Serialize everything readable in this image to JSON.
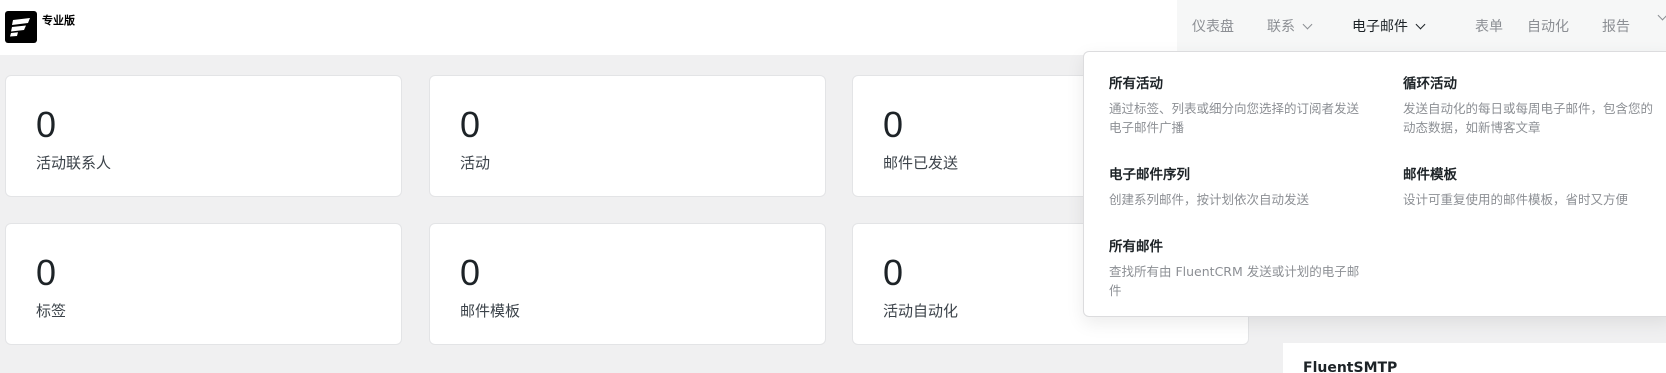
{
  "app": {
    "badge": "专业版"
  },
  "nav": {
    "items": [
      {
        "label": "仪表盘",
        "has_chevron": false,
        "active": false
      },
      {
        "label": "联系",
        "has_chevron": true,
        "active": false
      },
      {
        "label": "电子邮件",
        "has_chevron": true,
        "active": true
      },
      {
        "label": "表单",
        "has_chevron": false,
        "active": false
      },
      {
        "label": "自动化",
        "has_chevron": false,
        "active": false
      },
      {
        "label": "报告",
        "has_chevron": false,
        "active": false
      }
    ]
  },
  "stats": [
    {
      "value": "0",
      "label": "活动联系人"
    },
    {
      "value": "0",
      "label": "活动"
    },
    {
      "value": "0",
      "label": "邮件已发送"
    },
    {
      "value": "0",
      "label": "标签"
    },
    {
      "value": "0",
      "label": "邮件模板"
    },
    {
      "value": "0",
      "label": "活动自动化"
    }
  ],
  "dropdown": {
    "items": [
      {
        "title": "所有活动",
        "desc": "通过标签、列表或细分向您选择的订阅者发送电子邮件广播"
      },
      {
        "title": "循环活动",
        "desc": "发送自动化的每日或每周电子邮件，包含您的动态数据，如新博客文章"
      },
      {
        "title": "电子邮件序列",
        "desc": "创建系列邮件，按计划依次自动发送"
      },
      {
        "title": "邮件模板",
        "desc": "设计可重复使用的邮件模板，省时又方便"
      },
      {
        "title": "所有邮件",
        "desc": "查找所有由 FluentCRM 发送或计划的电子邮件"
      }
    ]
  },
  "side_panel": {
    "title": "FluentSMTP"
  },
  "colors": {
    "accent": "#1d2327",
    "muted": "#8c8f94",
    "background": "#f0f0f1"
  }
}
